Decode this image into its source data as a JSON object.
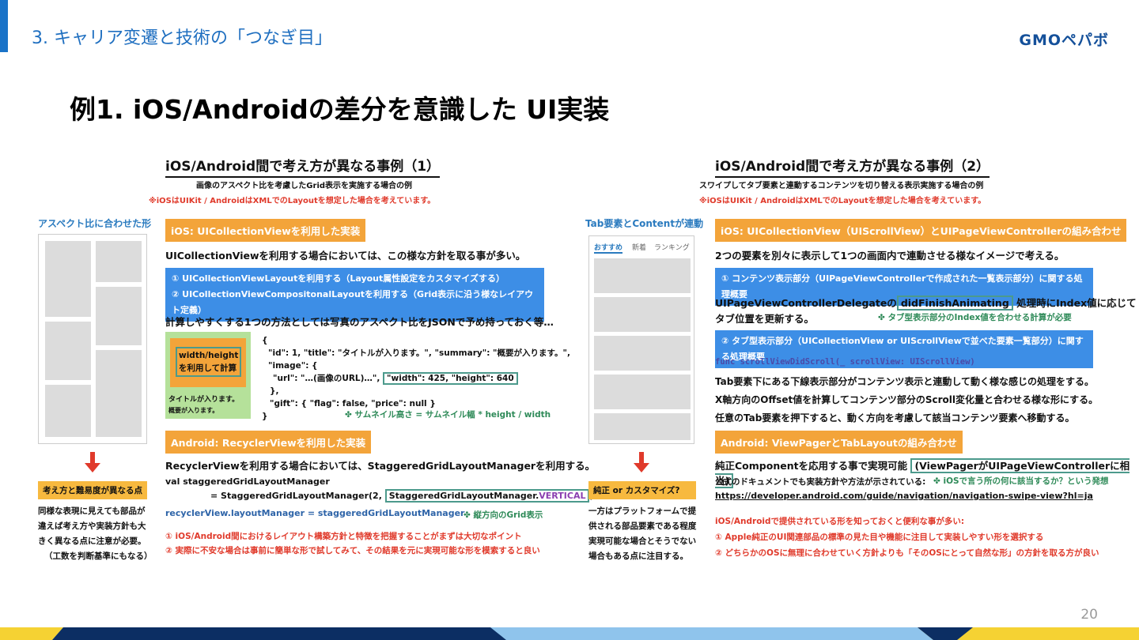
{
  "header": {
    "section": "3. キャリア変遷と技術の「つなぎ目」",
    "logo": "GMOペパボ",
    "title": "例1. iOS/Androidの差分を意識した UI実装",
    "page_number": "20"
  },
  "left": {
    "heading": "iOS/Android間で考え方が異なる事例（1）",
    "sub1": "画像のアスペクト比を考慮したGrid表示を実施する場合の例",
    "sub2": "※iOSはUIKit / AndroidはXMLでのLayoutを想定した場合を考えています。",
    "side_label": "アスペクト比に合わせた形",
    "consider_box": "考え方と難易度が異なる点",
    "consider_note": [
      "同様な表現に見えても部品が",
      "違えば考え方や実装方針も大",
      "きく異なる点に注意が必要。",
      "（工数を判断基準にもなる）"
    ],
    "ios_tag": "iOS: UICollectionViewを利用した実装",
    "ios_body": "UICollectionViewを利用する場合においては、この様な方針を取る事が多い。",
    "ios_points": [
      "① UICollectionViewLayoutを利用する（Layout属性設定をカスタマイズする）",
      "② UICollectionViewCompositonalLayoutを利用する（Grid表示に沿う様なレイアウト定義）"
    ],
    "calc_line": "計算しやすくする1つの方法としては写真のアスペクト比をJSONで予め持っておく等…",
    "card_box": [
      "width/height",
      "を利用して計算"
    ],
    "card_title": "タイトルが入ります。",
    "card_summary": "概要が入ります。",
    "json_lines": [
      "{",
      "\"id\": 1, \"title\": \"タイトルが入ります。\", \"summary\": \"概要が入ります。\",",
      "\"image\": {",
      "\"url\": \"…(画像のURL)…\",",
      "},",
      "\"gift\": { \"flag\": false, \"price\": null }",
      "}"
    ],
    "json_highlight": "\"width\": 425, \"height\": 640",
    "json_note": "サムネイル高さ = サムネイル幅 * height / width",
    "android_tag": "Android: RecyclerViewを利用した実装",
    "android_body": "RecyclerViewを利用する場合においては、StaggeredGridLayoutManagerを利用する。",
    "code1": "val staggeredGridLayoutManager",
    "code2a": "= StaggeredGridLayoutManager(2, ",
    "code2b": "StaggeredGridLayoutManager.",
    "code2c": "VERTICAL",
    "code2d": ")",
    "code3": "recyclerView.layoutManager = staggeredGridLayoutManager",
    "code_note": "縦方向のGrid表示",
    "tips": [
      "① iOS/Android間におけるレイアウト構築方針と特徴を把握することがまずは大切なポイント",
      "② 実際に不安な場合は事前に簡単な形で試してみて、その結果を元に実現可能な形を模索すると良い"
    ]
  },
  "right": {
    "heading": "iOS/Android間で考え方が異なる事例（2）",
    "sub1": "スワイプしてタブ要素と連動するコンテンツを切り替える表示実施する場合の例",
    "sub2": "※iOSはUIKit / AndroidはXMLでのLayoutを想定した場合を考えています。",
    "side_label": "Tab要素とContentが連動",
    "tabs": [
      "おすすめ",
      "新着",
      "ランキング"
    ],
    "pure_box": "純正 or カスタマイズ?",
    "pure_note": [
      "一方はプラットフォームで提",
      "供される部品要素である程度",
      "実現可能な場合とそうでない",
      "場合もある点に注目する。"
    ],
    "ios_tag": "iOS: UICollectionView（UIScrollView）とUIPageViewControllerの組み合わせ",
    "ios_body": "2つの要素を別々に表示して1つの画面内で連動させる様なイメージで考える。",
    "point1": "① コンテンツ表示部分（UIPageViewControllerで作成された一覧表示部分）に関する処理概要",
    "delegate_a": "UIPageViewControllerDelegateの",
    "delegate_b": "didFinishAnimating",
    "delegate_c": "処理時にIndex値に応じて",
    "delegate_d": "タブ位置を更新する。",
    "delegate_note": "タブ型表示部分のIndex値を合わせる計算が必要",
    "point2": "② タブ型表示部分（UICollectionView or UIScrollViewで並べた要素一覧部分）に関する処理概要",
    "func_line": "func scrollViewDidScroll(_ scrollView: UIScrollView)",
    "tab_lines": [
      "Tab要素下にある下線表示部分がコンテンツ表示と連動して動く様な感じの処理をする。",
      "X軸方向のOffset値を計算してコンテンツ部分のScroll変化量と合わせる様な形にする。",
      "任意のTab要素を押下すると、動く方向を考慮して該当コンテンツ要素へ移動する。"
    ],
    "android_tag": "Android: ViewPagerとTabLayoutの組み合わせ",
    "android_a": "純正Componentを応用する事で実現可能",
    "android_b": "(ViewPagerがUIPageViewControllerに相当)",
    "doc_line": "公式のドキュメントでも実装方針や方法が示されている:",
    "doc_note": "iOSで言う所の何に該当するか？という発想",
    "doc_url": "https://developer.android.com/guide/navigation/navigation-swipe-view?hl=ja",
    "tips": [
      "iOS/Androidで提供されている形を知っておくと便利な事が多い:",
      "① Apple純正のUI関連部品の標準の見た目や機能に注目して実装しやすい形を選択する",
      "② どちらかのOSに無理に合わせていく方針よりも「そのOSにとって自然な形」の方針を取る方が良い"
    ]
  },
  "colors": {
    "accent_blue": "#1f6fc0",
    "orange": "#f3a43a",
    "bar_blue": "#3d8ee6",
    "red": "#e03a2b",
    "green": "#2e8a58"
  }
}
